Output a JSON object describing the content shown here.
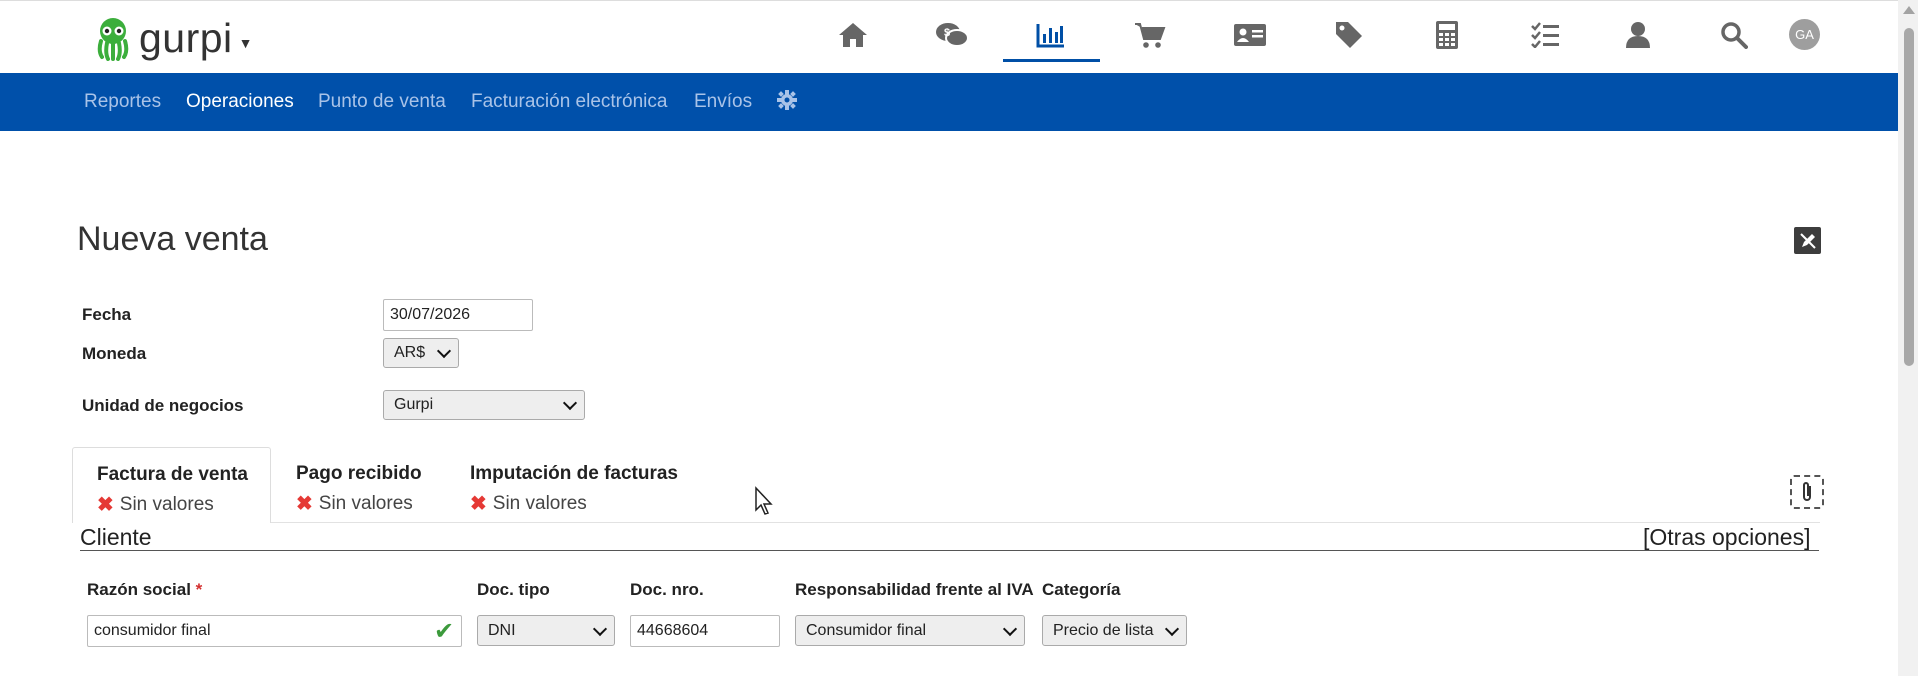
{
  "app": {
    "name": "gurpi"
  },
  "top_nav": {
    "icons": [
      "home-icon",
      "chat-money-icon",
      "bar-chart-icon",
      "cart-icon",
      "contact-card-icon",
      "tag-icon",
      "calculator-icon",
      "checklist-icon",
      "user-icon",
      "search-icon"
    ],
    "active": "bar-chart-icon",
    "avatar_initials": "GA"
  },
  "sub_nav": {
    "items": [
      {
        "label": "Reportes",
        "active": false
      },
      {
        "label": "Operaciones",
        "active": true
      },
      {
        "label": "Punto de venta",
        "active": false
      },
      {
        "label": "Facturación electrónica",
        "active": false
      },
      {
        "label": "Envíos",
        "active": false
      }
    ],
    "settings_icon": "gear-icon"
  },
  "page": {
    "title": "Nueva venta"
  },
  "form": {
    "fecha": {
      "label": "Fecha",
      "value": "30/07/2026"
    },
    "moneda": {
      "label": "Moneda",
      "value": "AR$"
    },
    "unidad": {
      "label": "Unidad de negocios",
      "value": "Gurpi"
    }
  },
  "tabs": [
    {
      "title": "Factura de venta",
      "status": "Sin valores",
      "active": true
    },
    {
      "title": "Pago recibido",
      "status": "Sin valores",
      "active": false
    },
    {
      "title": "Imputación de facturas",
      "status": "Sin valores",
      "active": false
    }
  ],
  "cliente": {
    "section_title": "Cliente",
    "other_options": "[Otras opciones]",
    "razon_social": {
      "label": "Razón social",
      "required_mark": "*",
      "value": "consumidor final"
    },
    "doc_tipo": {
      "label": "Doc. tipo",
      "value": "DNI"
    },
    "doc_nro": {
      "label": "Doc. nro.",
      "value": "44668604"
    },
    "resp_iva": {
      "label": "Responsabilidad frente al IVA",
      "value": "Consumidor final"
    },
    "categoria": {
      "label": "Categoría",
      "value": "Precio de lista"
    }
  },
  "colors": {
    "subnav_bg": "#0050aa",
    "active_accent": "#004fa6",
    "error_x": "#e53935",
    "check": "#3c9a3c"
  }
}
